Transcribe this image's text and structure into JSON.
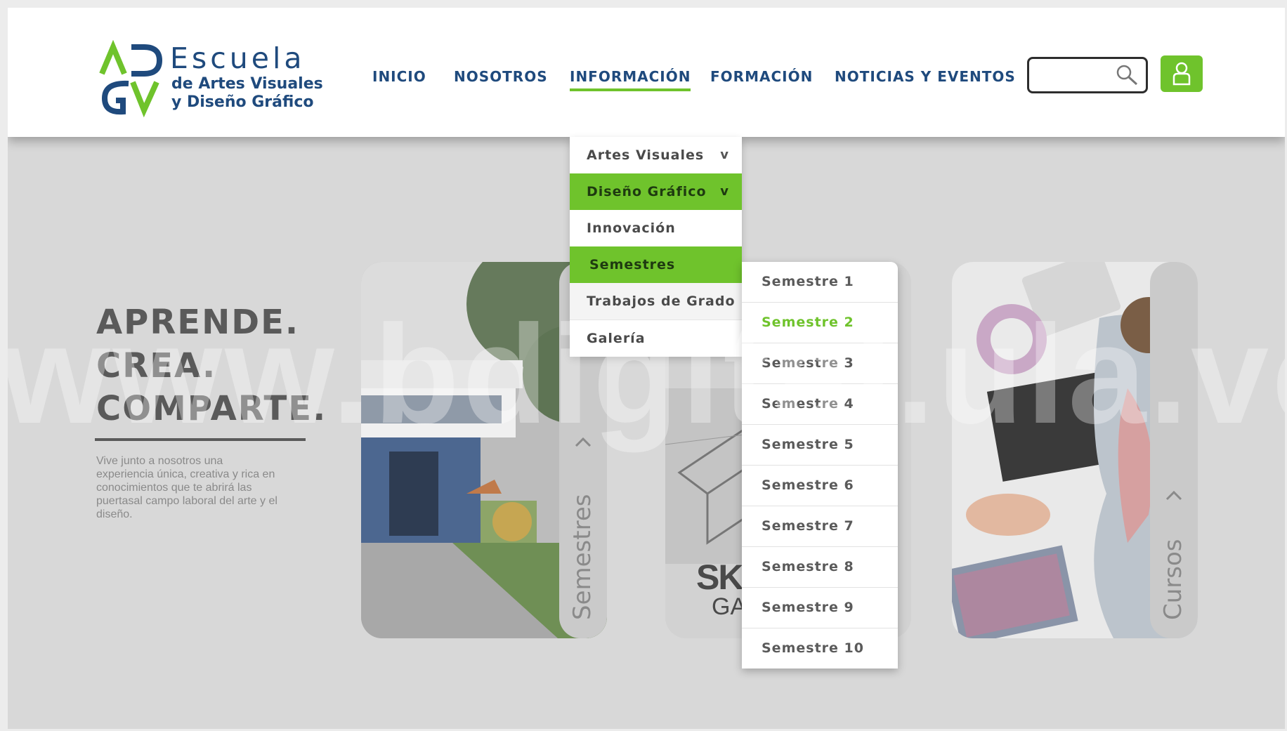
{
  "brand": {
    "name": "Escuela",
    "subtitle_line1": "de Artes Visuales",
    "subtitle_line2": "y Diseño Gráfico",
    "logo_letters": "ADGV",
    "colors": {
      "navy": "#1f4a7d",
      "green": "#6fc32c"
    }
  },
  "nav": {
    "items": [
      "INICIO",
      "NOSOTROS",
      "INFORMACIÓN",
      "FORMACIÓN",
      "NOTICIAS Y EVENTOS"
    ],
    "active": "INFORMACIÓN"
  },
  "search": {
    "value": "",
    "icon": "search-icon"
  },
  "user_button": {
    "icon": "user-icon"
  },
  "hero": {
    "title_lines": [
      "APRENDE.",
      "CREA.",
      "COMPARTE."
    ],
    "description": "Vive junto a nosotros una experiencia única, creativa y rica en conocimientos que te abrirá las puertasal campo laboral del arte y el diseño."
  },
  "dropdown": {
    "items": [
      {
        "label": "Artes Visuales",
        "chevron": "v"
      },
      {
        "label": "Diseño Gráfico",
        "chevron": "v"
      },
      {
        "label": "Innovación"
      },
      {
        "label": "Semestres"
      },
      {
        "label": "Trabajos de Grado"
      },
      {
        "label": "Galería"
      }
    ]
  },
  "semesters": {
    "items": [
      "Semestre 1",
      "Semestre 2",
      "Semestre 3",
      "Semestre 4",
      "Semestre 5",
      "Semestre 6",
      "Semestre 7",
      "Semestre 8",
      "Semestre 9",
      "Semestre 10"
    ],
    "selected": "Semestre 2"
  },
  "cards": [
    {
      "label": "Semestres",
      "icon": "chevron-up-icon"
    },
    {
      "text": "SKE",
      "text2": "GA"
    },
    {
      "label": "Cursos",
      "icon": "chevron-up-icon"
    }
  ],
  "watermark": "www.bdigital.ula.ve"
}
